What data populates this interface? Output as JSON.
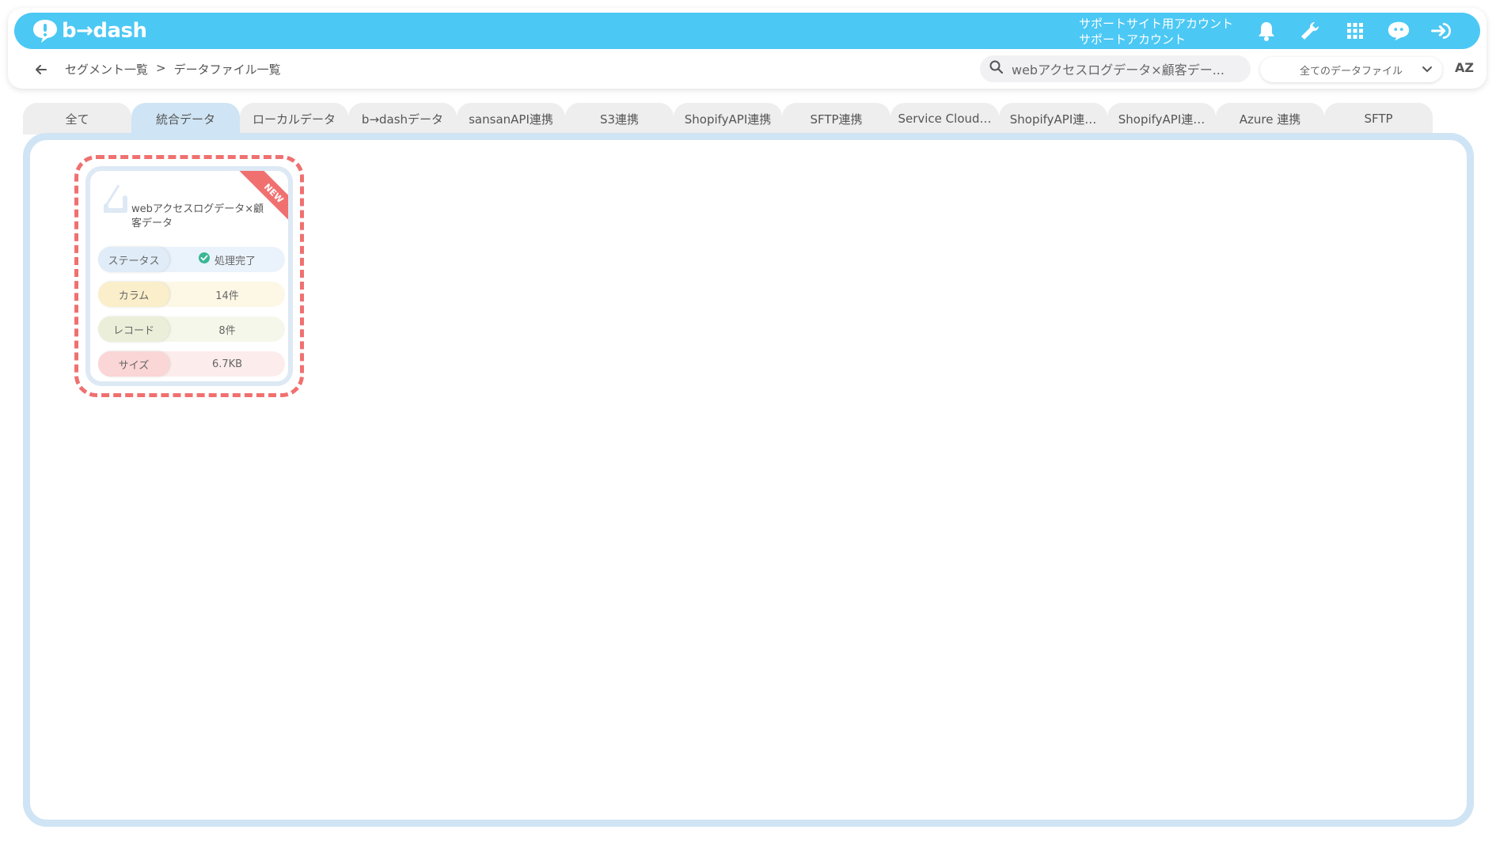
{
  "app": {
    "logo_text": "b→dash",
    "account_line1": "サポートサイト用アカウント",
    "account_line2": "サポートアカウント"
  },
  "icons": {
    "notifications": "bell-icon",
    "tools": "wrench-icon",
    "apps": "grid-icon",
    "assistant": "chat-bubble-icon",
    "logout": "logout-icon",
    "back": "arrow-left-icon",
    "search": "search-icon",
    "sort": "sort-az-icon"
  },
  "breadcrumb": {
    "parent": "セグメント一覧",
    "separator": ">",
    "current": "データファイル一覧"
  },
  "search": {
    "value": "webアクセスログデータ×顧客デー..."
  },
  "filter": {
    "selected": "全てのデータファイル"
  },
  "sort": {
    "label": "AZ"
  },
  "tabs": [
    {
      "label": "全て",
      "active": false
    },
    {
      "label": "統合データ",
      "active": true
    },
    {
      "label": "ローカルデータ",
      "active": false
    },
    {
      "label": "b→dashデータ",
      "active": false
    },
    {
      "label": "sansanAPI連携",
      "active": false
    },
    {
      "label": "S3連携",
      "active": false
    },
    {
      "label": "ShopifyAPI連携",
      "active": false
    },
    {
      "label": "SFTP連携",
      "active": false
    },
    {
      "label": "Service Cloud…",
      "active": false
    },
    {
      "label": "ShopifyAPI連…",
      "active": false
    },
    {
      "label": "ShopifyAPI連…",
      "active": false
    },
    {
      "label": "Azure 連携",
      "active": false
    },
    {
      "label": "SFTP",
      "active": false
    }
  ],
  "file_card": {
    "badge": "NEW",
    "name": "webアクセスログデータ×顧客データ",
    "status_label": "ステータス",
    "status_value": "処理完了",
    "column_label": "カラム",
    "column_value": "14件",
    "record_label": "レコード",
    "record_value": "8件",
    "size_label": "サイズ",
    "size_value": "6.7KB"
  },
  "colors": {
    "topbar": "#4cc8f4",
    "active_tab": "#cfe4f4",
    "highlight_dash": "#f07070",
    "status_ok": "#3ab795"
  }
}
